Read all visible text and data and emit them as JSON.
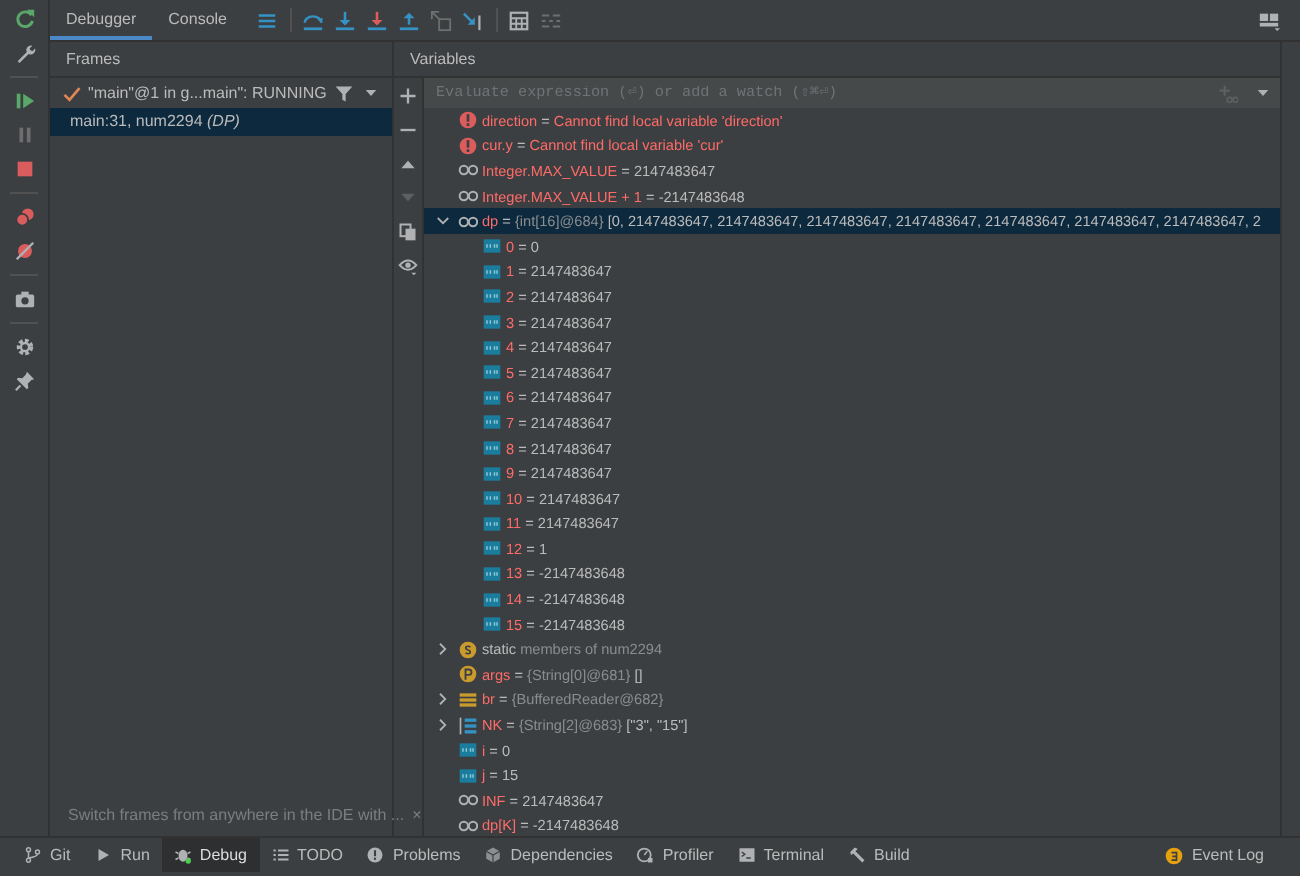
{
  "debug_tabs": [
    {
      "label": "Debugger",
      "selected": true
    },
    {
      "label": "Console",
      "selected": false
    }
  ],
  "frames": {
    "title": "Frames",
    "thread": "\"main\"@1 in g...main\": RUNNING",
    "items": [
      {
        "label": "main:31, num2294 *(DP)*",
        "selected": true
      }
    ],
    "hint": "Switch frames from anywhere in the IDE with ...",
    "hint_close": "×"
  },
  "variables": {
    "title": "Variables",
    "evaluate": {
      "placeholder": "Evaluate expression (⏎) or add a watch (⇧⌘⏎)"
    },
    "items": [
      {
        "kind": "error",
        "name": "direction",
        "op": "=",
        "value": "Cannot find local variable 'direction'",
        "selected": false
      },
      {
        "kind": "error",
        "name": "cur.y",
        "op": "=",
        "value": "Cannot find local variable 'cur'",
        "selected": false
      },
      {
        "kind": "watch",
        "name": "Integer.MAX_VALUE",
        "op": "=",
        "value": "2147483647",
        "selected": false
      },
      {
        "kind": "watch",
        "name": "Integer.MAX_VALUE + 1",
        "op": "=",
        "value": "-2147483648",
        "selected": false
      },
      {
        "kind": "watch",
        "name": "dp",
        "op": "=",
        "type": "{int[16]@684}",
        "value": "[0, 2147483647, 2147483647, 2147483647, 2147483647, 2147483647, 2147483647, 2147483647, 2",
        "selected": true,
        "expanded": true,
        "children": [
          {
            "kind": "element",
            "name": "0",
            "op": "=",
            "value": "0",
            "selected": false
          },
          {
            "kind": "element",
            "name": "1",
            "op": "=",
            "value": "2147483647",
            "selected": false
          },
          {
            "kind": "element",
            "name": "2",
            "op": "=",
            "value": "2147483647",
            "selected": false
          },
          {
            "kind": "element",
            "name": "3",
            "op": "=",
            "value": "2147483647",
            "selected": false
          },
          {
            "kind": "element",
            "name": "4",
            "op": "=",
            "value": "2147483647",
            "selected": false
          },
          {
            "kind": "element",
            "name": "5",
            "op": "=",
            "value": "2147483647",
            "selected": false
          },
          {
            "kind": "element",
            "name": "6",
            "op": "=",
            "value": "2147483647",
            "selected": false
          },
          {
            "kind": "element",
            "name": "7",
            "op": "=",
            "value": "2147483647",
            "selected": false
          },
          {
            "kind": "element",
            "name": "8",
            "op": "=",
            "value": "2147483647",
            "selected": false
          },
          {
            "kind": "element",
            "name": "9",
            "op": "=",
            "value": "2147483647",
            "selected": false
          },
          {
            "kind": "element",
            "name": "10",
            "op": "=",
            "value": "2147483647",
            "selected": false
          },
          {
            "kind": "element",
            "name": "11",
            "op": "=",
            "value": "2147483647",
            "selected": false
          },
          {
            "kind": "element",
            "name": "12",
            "op": "=",
            "value": "1",
            "selected": false
          },
          {
            "kind": "element",
            "name": "13",
            "op": "=",
            "value": "-2147483648",
            "selected": false
          },
          {
            "kind": "element",
            "name": "14",
            "op": "=",
            "value": "-2147483648",
            "selected": false
          },
          {
            "kind": "element",
            "name": "15",
            "op": "=",
            "value": "-2147483648",
            "selected": false
          }
        ]
      },
      {
        "kind": "static",
        "name": "static",
        "type": "members of num2294",
        "selected": false,
        "expanded": false
      },
      {
        "kind": "param",
        "name": "args",
        "op": "=",
        "type": "{String[0]@681}",
        "value": "[]",
        "selected": false
      },
      {
        "kind": "field",
        "name": "br",
        "op": "=",
        "type": "{BufferedReader@682}",
        "selected": false,
        "expanded": false
      },
      {
        "kind": "array",
        "name": "NK",
        "op": "=",
        "type": "{String[2]@683}",
        "value": "[\"3\", \"15\"]",
        "selected": false,
        "expanded": false
      },
      {
        "kind": "local",
        "name": "i",
        "op": "=",
        "value": "0",
        "selected": false
      },
      {
        "kind": "local",
        "name": "j",
        "op": "=",
        "value": "15",
        "selected": false
      },
      {
        "kind": "watch",
        "name": "INF",
        "op": "=",
        "value": "2147483647",
        "selected": false
      },
      {
        "kind": "watch",
        "name": "dp[K]",
        "op": "=",
        "value": "-2147483648",
        "selected": false
      }
    ]
  },
  "tool_windows": [
    {
      "label": "Git",
      "selected": false
    },
    {
      "label": "Run",
      "selected": false
    },
    {
      "label": "Debug",
      "selected": true
    },
    {
      "label": "TODO",
      "selected": false
    },
    {
      "label": "Problems",
      "selected": false
    },
    {
      "label": "Dependencies",
      "selected": false
    },
    {
      "label": "Profiler",
      "selected": false
    },
    {
      "label": "Terminal",
      "selected": false
    },
    {
      "label": "Build",
      "selected": false
    }
  ],
  "event_log": "Event Log"
}
